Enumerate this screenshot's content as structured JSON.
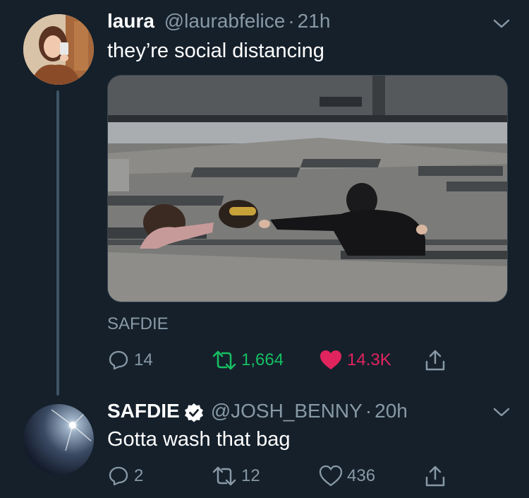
{
  "tweet1": {
    "display_name": "laura",
    "handle": "@laurabfelice",
    "separator": "·",
    "time": "21h",
    "text": "they’re social distancing",
    "caption": "SAFDIE",
    "replies": "14",
    "retweets": "1,664",
    "likes": "14.3K",
    "liked": true
  },
  "tweet2": {
    "display_name": "SAFDIE",
    "verified": true,
    "handle": "@JOSH_BENNY",
    "separator": "·",
    "time": "20h",
    "text": "Gotta wash that bag",
    "replies": "2",
    "retweets": "12",
    "likes": "436"
  },
  "colors": {
    "background": "#15202b",
    "secondary_text": "#8899a6",
    "retweet_green": "#17bf63",
    "like_red": "#e0245e",
    "thread_line": "#3d5466"
  },
  "icons": [
    "reply-icon",
    "retweet-icon",
    "like-icon",
    "share-icon",
    "chevron-down-icon",
    "verified-badge-icon"
  ]
}
